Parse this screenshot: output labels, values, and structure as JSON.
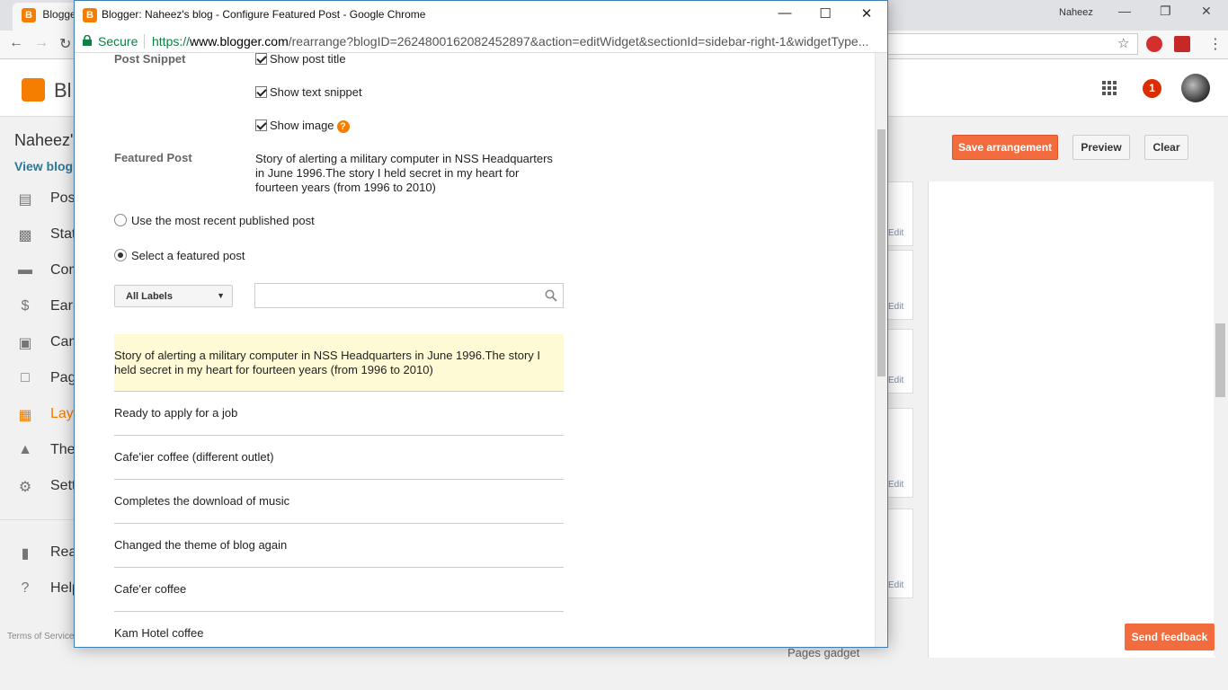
{
  "background": {
    "tab_title": "Blogger",
    "user_name": "Naheez",
    "logo_text": "Bl",
    "blog_title": "Naheez's",
    "view_blog": "View blog",
    "notif_count": "1",
    "nav": [
      {
        "label": "Posts",
        "icon": "posts-icon"
      },
      {
        "label": "Stats",
        "icon": "stats-icon"
      },
      {
        "label": "Comments",
        "icon": "comments-icon"
      },
      {
        "label": "Earnings",
        "icon": "earnings-icon"
      },
      {
        "label": "Campaigns",
        "icon": "campaigns-icon"
      },
      {
        "label": "Pages",
        "icon": "pages-icon"
      },
      {
        "label": "Layout",
        "icon": "layout-icon",
        "active": true
      },
      {
        "label": "Theme",
        "icon": "theme-icon"
      },
      {
        "label": "Settings",
        "icon": "settings-icon"
      }
    ],
    "nav2": [
      {
        "label": "Reading List",
        "icon": "bookmark-icon"
      },
      {
        "label": "Help",
        "icon": "help-icon"
      }
    ],
    "terms": "Terms of Service",
    "save_arrangement": "Save arrangement",
    "preview": "Preview",
    "clear": "Clear",
    "gadget_edit": "Edit",
    "pages_gadget": "Pages gadget",
    "send_feedback": "Send feedback",
    "accent_color": "#f57d00"
  },
  "popup": {
    "title": "Blogger: Naheez's blog - Configure Featured Post - Google Chrome",
    "secure": "Secure",
    "url_scheme": "https://",
    "url_host": "www.blogger.com",
    "url_path": "/rearrange?blogID=2624800162082452897&action=editWidget&sectionId=sidebar-right-1&widgetType...",
    "post_snippet_label": "Post Snippet",
    "show_post_title": "Show post title",
    "show_text_snippet": "Show text snippet",
    "show_image": "Show image",
    "featured_post_label": "Featured Post",
    "featured_post_value": "Story of alerting a military computer in NSS Headquarters in June 1996.The story I held secret in my heart for fourteen years (from 1996 to 2010)",
    "radio_recent": "Use the most recent published post",
    "radio_select": "Select a featured post",
    "labels_select": "All Labels",
    "search_placeholder": "",
    "posts": [
      "Story of alerting a military computer in NSS Headquarters in June 1996.The story I held secret in my heart for fourteen years (from 1996 to 2010)",
      "Ready to apply for a job",
      "Cafe'ier coffee (different outlet)",
      "Completes the download of music",
      "Changed the theme of blog again",
      "Cafe'er coffee",
      "Kam Hotel coffee"
    ]
  }
}
